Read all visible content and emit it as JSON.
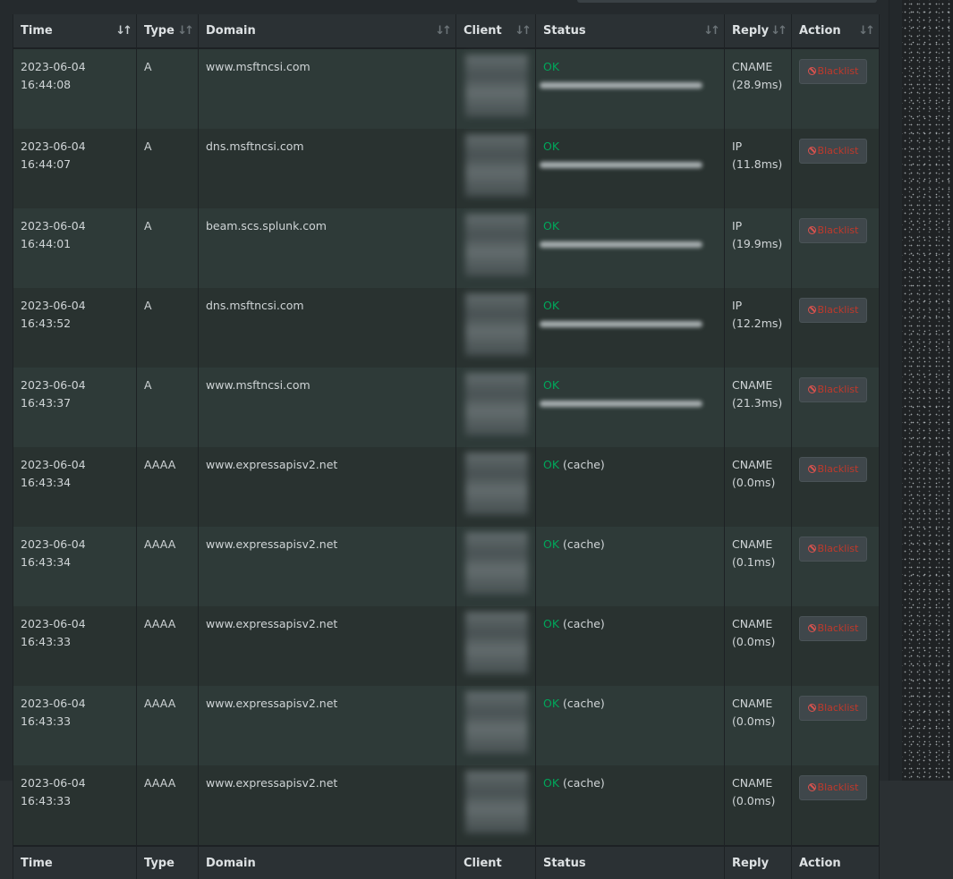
{
  "columns": [
    "Time",
    "Type",
    "Domain",
    "Client",
    "Status",
    "Reply",
    "Action"
  ],
  "rows": [
    {
      "time": "2023-06-04 16:44:08",
      "type": "A",
      "domain": "www.msftncsi.com",
      "status": "OK",
      "status_extra": "",
      "reply_type": "CNAME",
      "reply_time": "(28.9ms)",
      "action": "Blacklist"
    },
    {
      "time": "2023-06-04 16:44:07",
      "type": "A",
      "domain": "dns.msftncsi.com",
      "status": "OK",
      "status_extra": "",
      "reply_type": "IP",
      "reply_time": "(11.8ms)",
      "action": "Blacklist"
    },
    {
      "time": "2023-06-04 16:44:01",
      "type": "A",
      "domain": "beam.scs.splunk.com",
      "status": "OK",
      "status_extra": "",
      "reply_type": "IP",
      "reply_time": "(19.9ms)",
      "action": "Blacklist"
    },
    {
      "time": "2023-06-04 16:43:52",
      "type": "A",
      "domain": "dns.msftncsi.com",
      "status": "OK",
      "status_extra": "",
      "reply_type": "IP",
      "reply_time": "(12.2ms)",
      "action": "Blacklist"
    },
    {
      "time": "2023-06-04 16:43:37",
      "type": "A",
      "domain": "www.msftncsi.com",
      "status": "OK",
      "status_extra": "",
      "reply_type": "CNAME",
      "reply_time": "(21.3ms)",
      "action": "Blacklist"
    },
    {
      "time": "2023-06-04 16:43:34",
      "type": "AAAA",
      "domain": "www.expressapisv2.net",
      "status": "OK",
      "status_extra": "(cache)",
      "reply_type": "CNAME",
      "reply_time": "(0.0ms)",
      "action": "Blacklist"
    },
    {
      "time": "2023-06-04 16:43:34",
      "type": "AAAA",
      "domain": "www.expressapisv2.net",
      "status": "OK",
      "status_extra": "(cache)",
      "reply_type": "CNAME",
      "reply_time": "(0.1ms)",
      "action": "Blacklist"
    },
    {
      "time": "2023-06-04 16:43:33",
      "type": "AAAA",
      "domain": "www.expressapisv2.net",
      "status": "OK",
      "status_extra": "(cache)",
      "reply_type": "CNAME",
      "reply_time": "(0.0ms)",
      "action": "Blacklist"
    },
    {
      "time": "2023-06-04 16:43:33",
      "type": "AAAA",
      "domain": "www.expressapisv2.net",
      "status": "OK",
      "status_extra": "(cache)",
      "reply_type": "CNAME",
      "reply_time": "(0.0ms)",
      "action": "Blacklist"
    },
    {
      "time": "2023-06-04 16:43:33",
      "type": "AAAA",
      "domain": "www.expressapisv2.net",
      "status": "OK",
      "status_extra": "(cache)",
      "reply_type": "CNAME",
      "reply_time": "(0.0ms)",
      "action": "Blacklist"
    }
  ],
  "colors": {
    "ok": "#00a65a",
    "blacklist": "#c0392b",
    "row_odd": "#2e3a38",
    "row_even": "#293230"
  },
  "icons": {
    "sort": "sort-icon",
    "blacklist": "ban-icon"
  }
}
